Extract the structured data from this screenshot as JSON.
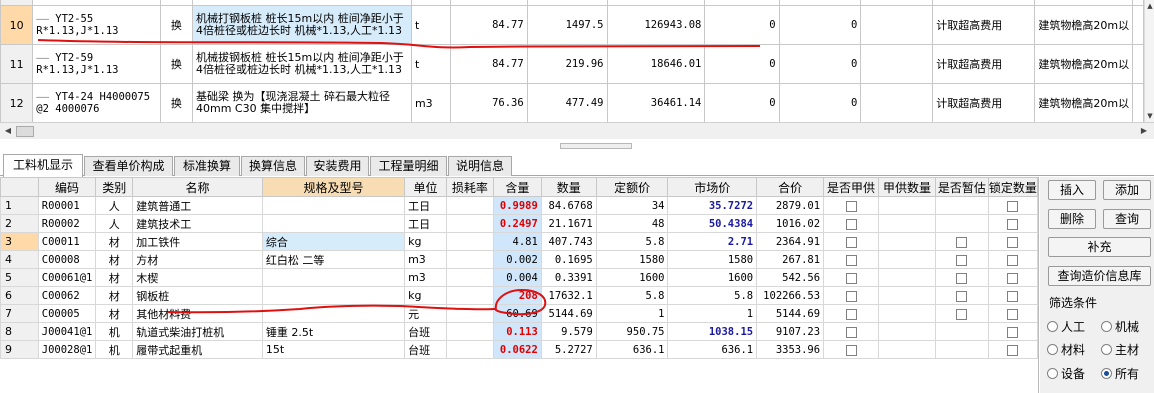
{
  "top_rows": [
    {
      "num": "10",
      "code": "YT2-55 R*1.13,J*1.13",
      "type": "换",
      "name": "机械打钢板桩 桩长15m以内 桩间净距小于4倍桩径或桩边长时 机械*1.13,人工*1.13",
      "unit": "t",
      "qty": "84.77",
      "price": "1497.5",
      "total": "126943.08",
      "c1": "0",
      "c2": "0",
      "fee": "计取超高费用",
      "cat": "建筑物檐高20m以"
    },
    {
      "num": "11",
      "code": "YT2-59 R*1.13,J*1.13",
      "type": "换",
      "name": "机械拔钢板桩 桩长15m以内 桩间净距小于4倍桩径或桩边长时 机械*1.13,人工*1.13",
      "unit": "t",
      "qty": "84.77",
      "price": "219.96",
      "total": "18646.01",
      "c1": "0",
      "c2": "0",
      "fee": "计取超高费用",
      "cat": "建筑物檐高20m以"
    },
    {
      "num": "12",
      "code": "YT4-24 H4000075 @2 4000076",
      "type": "换",
      "name": "基础梁 换为【现浇混凝土 碎石最大粒径40mm C30 集中搅拌】",
      "unit": "m3",
      "qty": "76.36",
      "price": "477.49",
      "total": "36461.14",
      "c1": "0",
      "c2": "0",
      "fee": "计取超高费用",
      "cat": "建筑物檐高20m以"
    }
  ],
  "tabs": [
    "工料机显示",
    "查看单价构成",
    "标准换算",
    "换算信息",
    "安装费用",
    "工程量明细",
    "说明信息"
  ],
  "columns": [
    "编码",
    "类别",
    "名称",
    "规格及型号",
    "单位",
    "损耗率",
    "含量",
    "数量",
    "定额价",
    "市场价",
    "合价",
    "是否甲供",
    "甲供数量",
    "是否暂估",
    "锁定数量"
  ],
  "rows": [
    {
      "num": "1",
      "code": "R00001",
      "cat": "人",
      "name": "建筑普通工",
      "spec": "",
      "unit": "工日",
      "loss": "",
      "content": "0.9989",
      "qty": "84.6768",
      "quota": "34",
      "market": "35.7272",
      "total": "2879.01",
      "zg": false
    },
    {
      "num": "2",
      "code": "R00002",
      "cat": "人",
      "name": "建筑技术工",
      "spec": "",
      "unit": "工日",
      "loss": "",
      "content": "0.2497",
      "qty": "21.1671",
      "quota": "48",
      "market": "50.4384",
      "total": "1016.02",
      "zg": false
    },
    {
      "num": "3",
      "code": "C00011",
      "cat": "材",
      "name": "加工铁件",
      "spec": "综合",
      "unit": "kg",
      "loss": "",
      "content": "4.81",
      "qty": "407.743",
      "quota": "5.8",
      "market": "2.71",
      "total": "2364.91",
      "zg": true
    },
    {
      "num": "4",
      "code": "C00008",
      "cat": "材",
      "name": "方材",
      "spec": "红白松 二等",
      "unit": "m3",
      "loss": "",
      "content": "0.002",
      "qty": "0.1695",
      "quota": "1580",
      "market": "1580",
      "total": "267.81",
      "zg": true
    },
    {
      "num": "5",
      "code": "C00061@1",
      "cat": "材",
      "name": "木楔",
      "spec": "",
      "unit": "m3",
      "loss": "",
      "content": "0.004",
      "qty": "0.3391",
      "quota": "1600",
      "market": "1600",
      "total": "542.56",
      "zg": true
    },
    {
      "num": "6",
      "code": "C00062",
      "cat": "材",
      "name": "钢板桩",
      "spec": "",
      "unit": "kg",
      "loss": "",
      "content": "208",
      "qty": "17632.1",
      "quota": "5.8",
      "market": "5.8",
      "total": "102266.53",
      "zg": true
    },
    {
      "num": "7",
      "code": "C00005",
      "cat": "材",
      "name": "其他材料费",
      "spec": "",
      "unit": "元",
      "loss": "",
      "content": "60.69",
      "qty": "5144.69",
      "quota": "1",
      "market": "1",
      "total": "5144.69",
      "zg": true
    },
    {
      "num": "8",
      "code": "J00041@1",
      "cat": "机",
      "name": "轨道式柴油打桩机",
      "spec": "锤重 2.5t",
      "unit": "台班",
      "loss": "",
      "content": "0.113",
      "qty": "9.579",
      "quota": "950.75",
      "market": "1038.15",
      "total": "9107.23",
      "zg": false
    },
    {
      "num": "9",
      "code": "J00028@1",
      "cat": "机",
      "name": "履带式起重机",
      "spec": "15t",
      "unit": "台班",
      "loss": "",
      "content": "0.0622",
      "qty": "5.2727",
      "quota": "636.1",
      "market": "636.1",
      "total": "3353.96",
      "zg": false
    }
  ],
  "buttons": {
    "insert": "插入",
    "add": "添加",
    "delete": "删除",
    "query": "查询",
    "supplement": "补充",
    "price_lib": "查询造价信息库"
  },
  "filter": {
    "title": "筛选条件",
    "labor": "人工",
    "machine": "机械",
    "material": "材料",
    "main_material": "主材",
    "equipment": "设备",
    "all": "所有"
  },
  "colors": {
    "red_value": "#e00000",
    "blue_value": "#1a1aa0",
    "annotation": "#e01010",
    "selected_row": "#ffd9a8",
    "selected_cell": "#d7ecfb"
  }
}
